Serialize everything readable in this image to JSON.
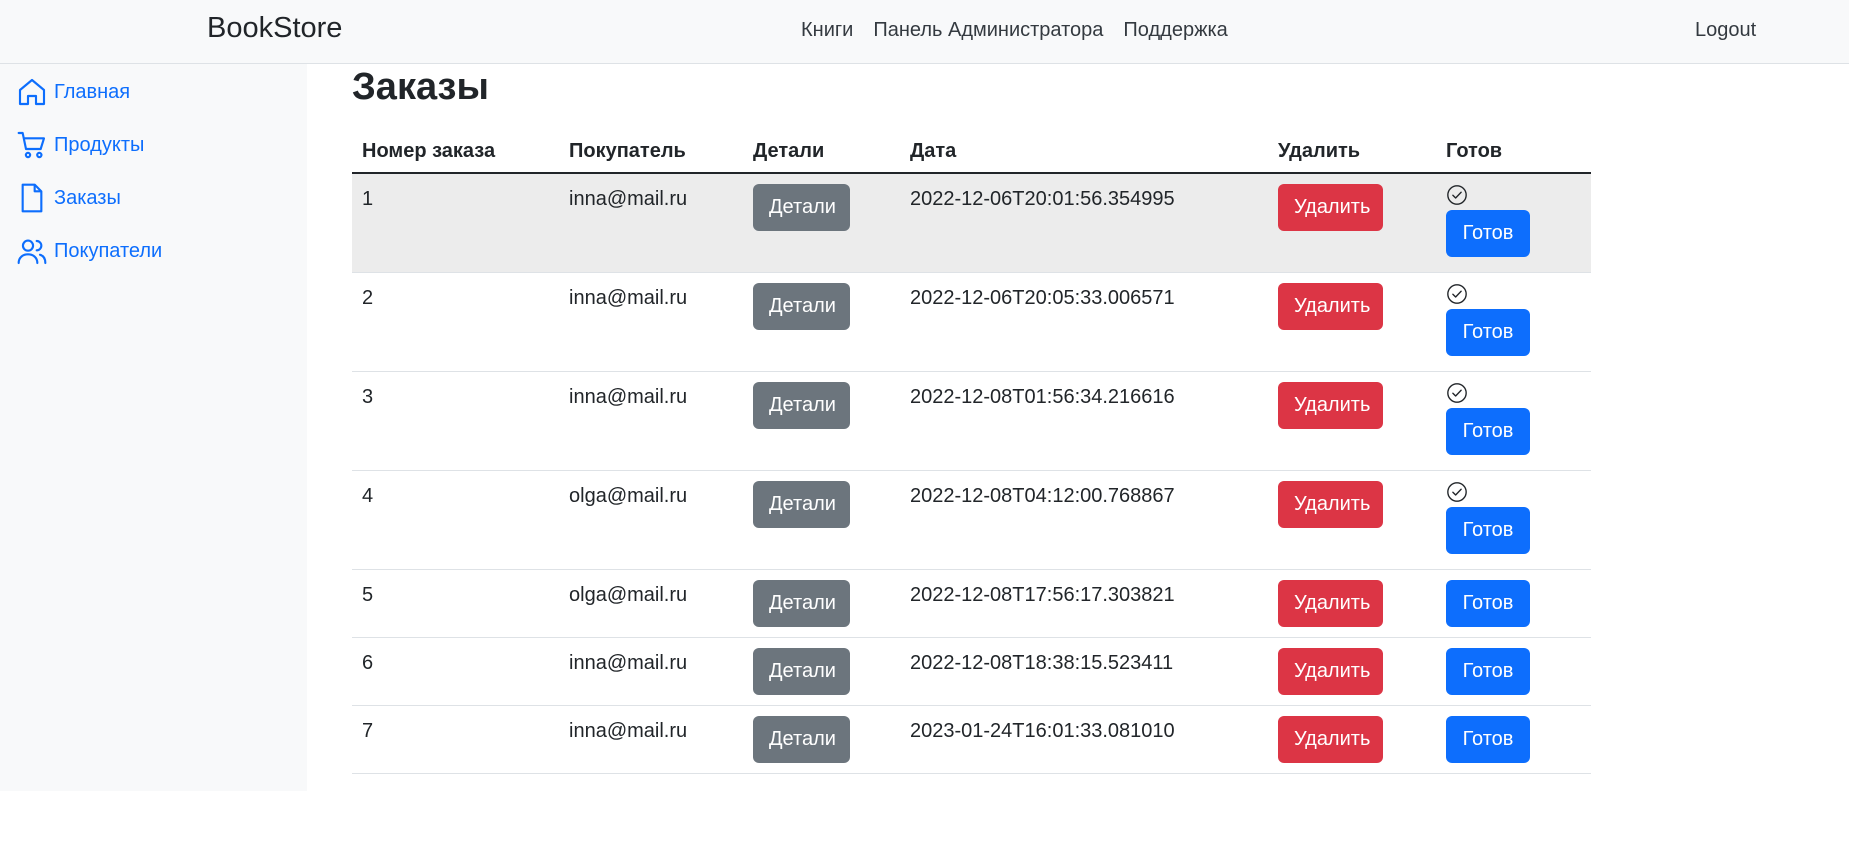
{
  "navbar": {
    "brand": "BookStore",
    "links": [
      "Книги",
      "Панель Администратора",
      "Поддержка"
    ],
    "logout": "Logout"
  },
  "sidebar": {
    "items": [
      {
        "label": "Главная",
        "icon": "home-icon"
      },
      {
        "label": "Продукты",
        "icon": "cart-icon"
      },
      {
        "label": "Заказы",
        "icon": "file-icon"
      },
      {
        "label": "Покупатели",
        "icon": "users-icon"
      }
    ]
  },
  "page": {
    "title": "Заказы"
  },
  "table": {
    "headers": [
      "Номер заказа",
      "Покупатель",
      "Детали",
      "Дата",
      "Удалить",
      "Готов"
    ],
    "details_label": "Детали",
    "delete_label": "Удалить",
    "ready_label": "Готов",
    "rows": [
      {
        "id": "1",
        "customer": "inna@mail.ru",
        "date": "2022-12-06T20:01:56.354995",
        "done": true
      },
      {
        "id": "2",
        "customer": "inna@mail.ru",
        "date": "2022-12-06T20:05:33.006571",
        "done": true
      },
      {
        "id": "3",
        "customer": "inna@mail.ru",
        "date": "2022-12-08T01:56:34.216616",
        "done": true
      },
      {
        "id": "4",
        "customer": "olga@mail.ru",
        "date": "2022-12-08T04:12:00.768867",
        "done": true
      },
      {
        "id": "5",
        "customer": "olga@mail.ru",
        "date": "2022-12-08T17:56:17.303821",
        "done": false
      },
      {
        "id": "6",
        "customer": "inna@mail.ru",
        "date": "2022-12-08T18:38:15.523411",
        "done": false
      },
      {
        "id": "7",
        "customer": "inna@mail.ru",
        "date": "2023-01-24T16:01:33.081010",
        "done": false
      }
    ]
  },
  "colors": {
    "primary": "#0d6efd",
    "danger": "#dc3545",
    "secondary": "#6c757d",
    "sidebar_bg": "#f8f9fa"
  }
}
